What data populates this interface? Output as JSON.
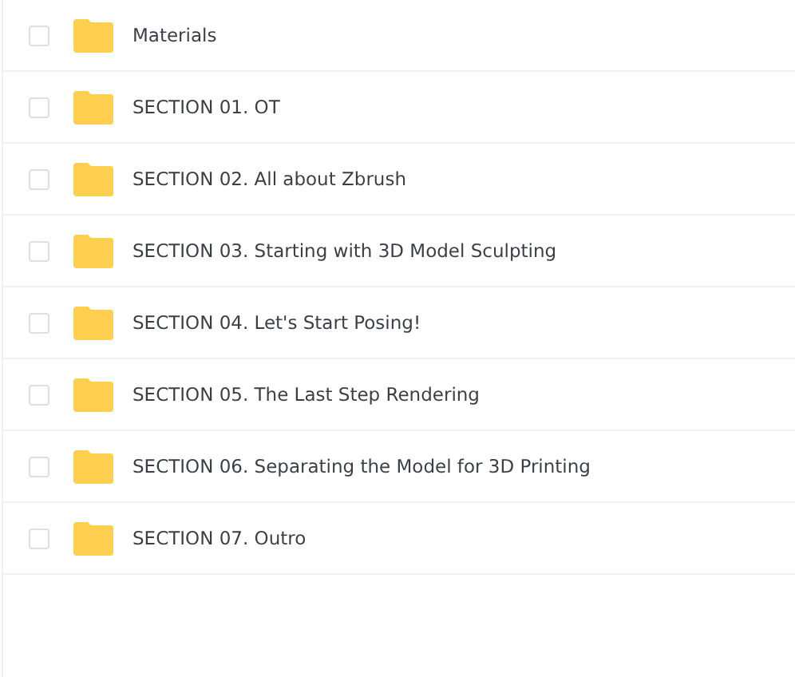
{
  "items": [
    {
      "name": "Materials",
      "checked": false
    },
    {
      "name": "SECTION 01. OT",
      "checked": false
    },
    {
      "name": "SECTION 02. All about Zbrush",
      "checked": false
    },
    {
      "name": "SECTION 03. Starting with 3D Model Sculpting",
      "checked": false
    },
    {
      "name": "SECTION 04. Let's Start Posing!",
      "checked": false
    },
    {
      "name": "SECTION 05. The Last Step Rendering",
      "checked": false
    },
    {
      "name": "SECTION 06. Separating the Model for 3D Printing",
      "checked": false
    },
    {
      "name": "SECTION 07. Outro",
      "checked": false
    }
  ]
}
